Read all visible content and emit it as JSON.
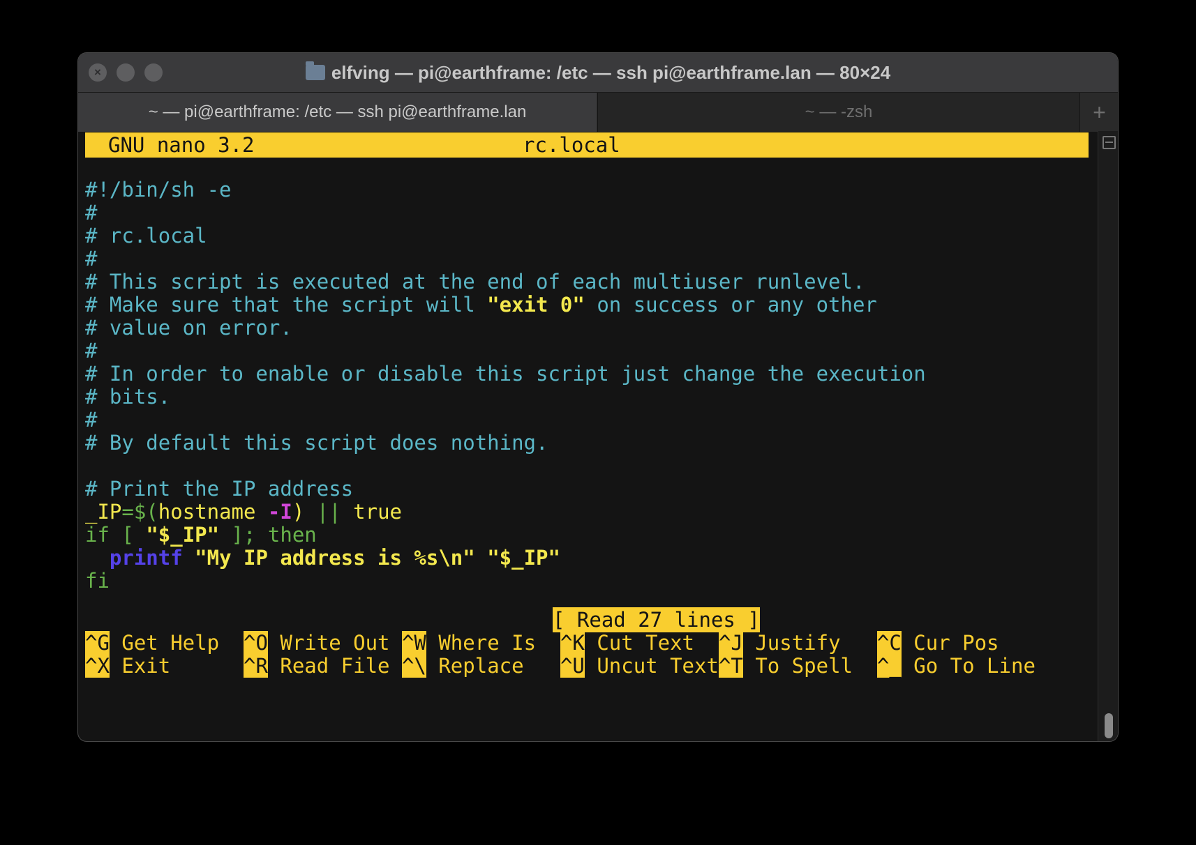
{
  "window": {
    "title": "elfving — pi@earthframe: /etc — ssh pi@earthframe.lan — 80×24",
    "icon": "folder-icon"
  },
  "tabs": [
    {
      "label": "~ — pi@earthframe: /etc — ssh pi@earthframe.lan",
      "active": true
    },
    {
      "label": "~ — -zsh",
      "active": false
    }
  ],
  "new_tab_label": "+",
  "nano": {
    "app": "GNU nano 3.2",
    "filename": "rc.local",
    "status": "[ Read 27 lines ]",
    "lines": [
      "",
      "#!/bin/sh -e",
      "#",
      "# rc.local",
      "#",
      "# This script is executed at the end of each multiuser runlevel.",
      "# Make sure that the script will ",
      "\"exit 0\"",
      " on success or any other",
      "# value on error.",
      "#",
      "# In order to enable or disable this script just change the execution",
      "# bits.",
      "#",
      "# By default this script does nothing.",
      "",
      "# Print the IP address",
      "_IP",
      "=$(",
      "hostname ",
      "-I",
      ")",
      " || ",
      "true",
      "if [ ",
      "\"$_IP\"",
      " ]; then",
      "  ",
      "printf",
      " ",
      "\"My IP address is %s\\n\"",
      " ",
      "\"$_IP\"",
      "fi"
    ],
    "shortcuts_row1": [
      {
        "key": "^G",
        "label": " Get Help  "
      },
      {
        "key": "^O",
        "label": " Write Out "
      },
      {
        "key": "^W",
        "label": " Where Is  "
      },
      {
        "key": "^K",
        "label": " Cut Text  "
      },
      {
        "key": "^J",
        "label": " Justify   "
      },
      {
        "key": "^C",
        "label": " Cur Pos"
      }
    ],
    "shortcuts_row2": [
      {
        "key": "^X",
        "label": " Exit      "
      },
      {
        "key": "^R",
        "label": " Read File "
      },
      {
        "key": "^\\",
        "label": " Replace   "
      },
      {
        "key": "^U",
        "label": " Uncut Text"
      },
      {
        "key": "^T",
        "label": " To Spell  "
      },
      {
        "key": "^_",
        "label": " Go To Line"
      }
    ]
  },
  "colors": {
    "header_bg": "#f9ce2f",
    "comment": "#5bb7c7",
    "keyword": "#69b34c",
    "string": "#f3e84e",
    "option": "#d046d8",
    "command": "#5542e8"
  },
  "scrollbar_icon": "split-pane-icon"
}
